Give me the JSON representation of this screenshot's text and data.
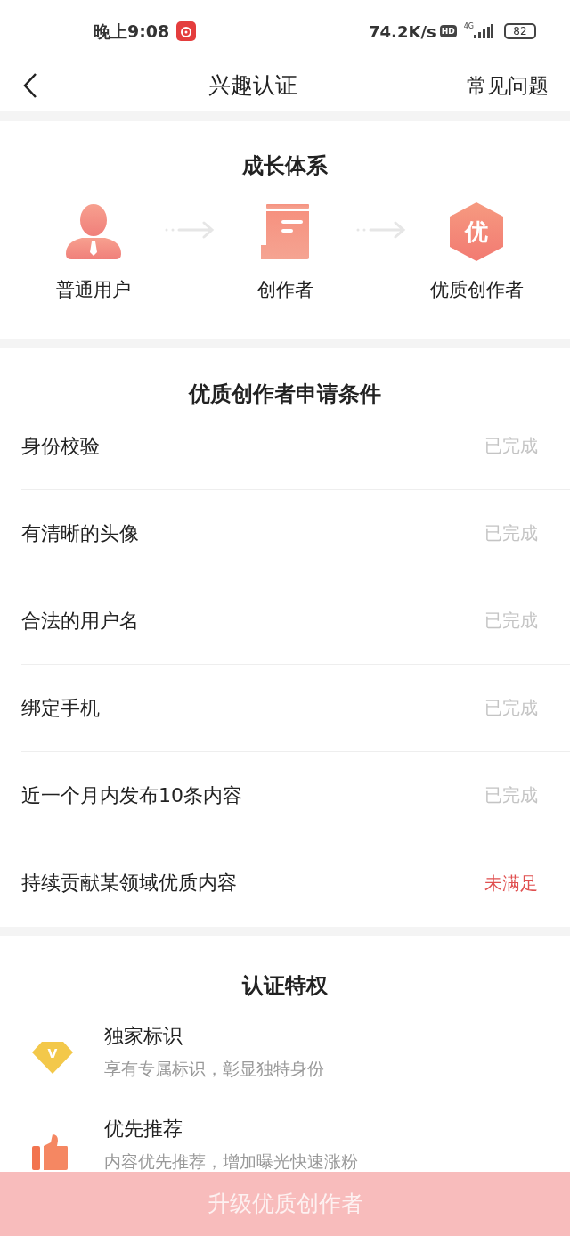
{
  "status_bar": {
    "time": "晚上9:08",
    "speed": "74.2K/s",
    "hd": "HD",
    "network": "4G",
    "battery": "82"
  },
  "header": {
    "title": "兴趣认证",
    "action": "常见问题"
  },
  "growth": {
    "title": "成长体系",
    "steps": [
      {
        "kind": "user",
        "label": "普通用户"
      },
      {
        "kind": "document",
        "label": "创作者"
      },
      {
        "kind": "badge",
        "label": "优质创作者",
        "badge_text": "优"
      }
    ]
  },
  "conditions": {
    "title": "优质创作者申请条件",
    "items": [
      {
        "label": "身份校验",
        "status": "已完成",
        "done": true
      },
      {
        "label": "有清晰的头像",
        "status": "已完成",
        "done": true
      },
      {
        "label": "合法的用户名",
        "status": "已完成",
        "done": true
      },
      {
        "label": "绑定手机",
        "status": "已完成",
        "done": true
      },
      {
        "label": "近一个月内发布10条内容",
        "status": "已完成",
        "done": true
      },
      {
        "label": "持续贡献某领域优质内容",
        "status": "未满足",
        "done": false
      }
    ]
  },
  "privileges": {
    "title": "认证特权",
    "items": [
      {
        "kind": "diamond",
        "icon_text": "V",
        "title": "独家标识",
        "description": "享有专属标识，彰显独特身份"
      },
      {
        "kind": "thumb",
        "title": "优先推荐",
        "description": "内容优先推荐，增加曝光快速涨粉"
      }
    ]
  },
  "upgrade_button": {
    "label": "升级优质创作者"
  }
}
